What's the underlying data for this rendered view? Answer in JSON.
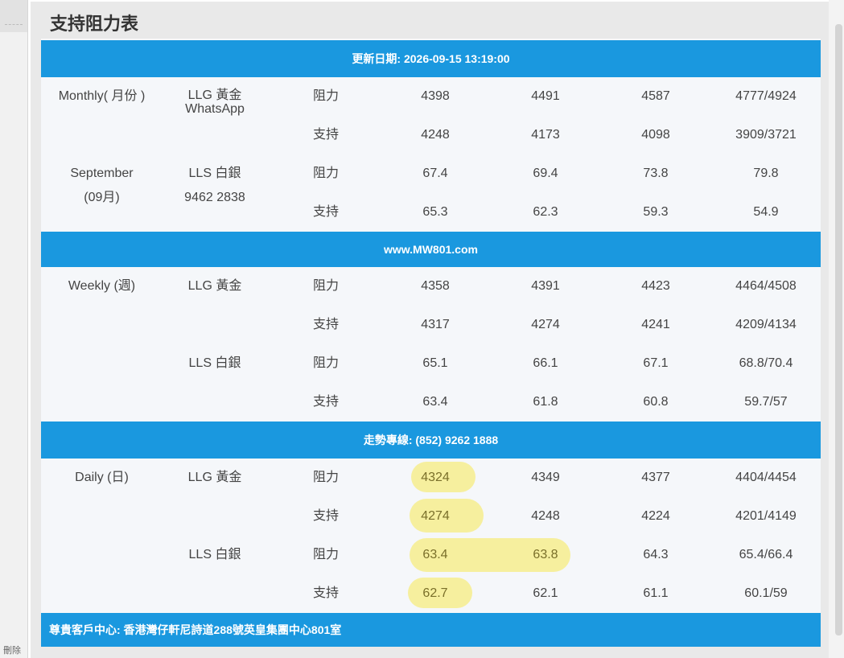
{
  "title": "支持阻力表",
  "left_sidebar_text": "刪除",
  "banners": {
    "update": "更新日期: 2026-09-15 13:19:00",
    "website": "www.MW801.com",
    "hotline": "走勢專線: (852) 9262 1888",
    "address": "尊貴客戶中心: 香港灣仔軒尼詩道288號英皇集團中心801室"
  },
  "sections": {
    "monthly": {
      "period": "Monthly( 月份 )",
      "period_sub": "September",
      "period_sub2": "(09月)",
      "gold_name": "LLG 黃金",
      "contact_label": "WhatsApp",
      "silver_name": "LLS 白銀",
      "contact_number": "9462 2838",
      "gold_resistance": [
        "4398",
        "4491",
        "4587",
        "4777/4924"
      ],
      "gold_support": [
        "4248",
        "4173",
        "4098",
        "3909/3721"
      ],
      "silver_resistance": [
        "67.4",
        "69.4",
        "73.8",
        "79.8"
      ],
      "silver_support": [
        "65.3",
        "62.3",
        "59.3",
        "54.9"
      ]
    },
    "weekly": {
      "period": "Weekly (週)",
      "gold_name": "LLG 黃金",
      "silver_name": "LLS 白銀",
      "gold_resistance": [
        "4358",
        "4391",
        "4423",
        "4464/4508"
      ],
      "gold_support": [
        "4317",
        "4274",
        "4241",
        "4209/4134"
      ],
      "silver_resistance": [
        "65.1",
        "66.1",
        "67.1",
        "68.8/70.4"
      ],
      "silver_support": [
        "63.4",
        "61.8",
        "60.8",
        "59.7/57"
      ]
    },
    "daily": {
      "period": "Daily (日)",
      "gold_name": "LLG 黃金",
      "silver_name": "LLS 白銀",
      "gold_resistance": [
        "4324",
        "4349",
        "4377",
        "4404/4454"
      ],
      "gold_support": [
        "4274",
        "4248",
        "4224",
        "4201/4149"
      ],
      "silver_resistance": [
        "63.4",
        "63.8",
        "64.3",
        "65.4/66.4"
      ],
      "silver_support": [
        "62.7",
        "62.1",
        "61.1",
        "60.1/59"
      ]
    }
  },
  "labels": {
    "resistance": "阻力",
    "support": "支持"
  },
  "colors": {
    "banner": "#1a98df",
    "table_bg": "#f5f7fa",
    "highlight": "#f6ef9e"
  }
}
